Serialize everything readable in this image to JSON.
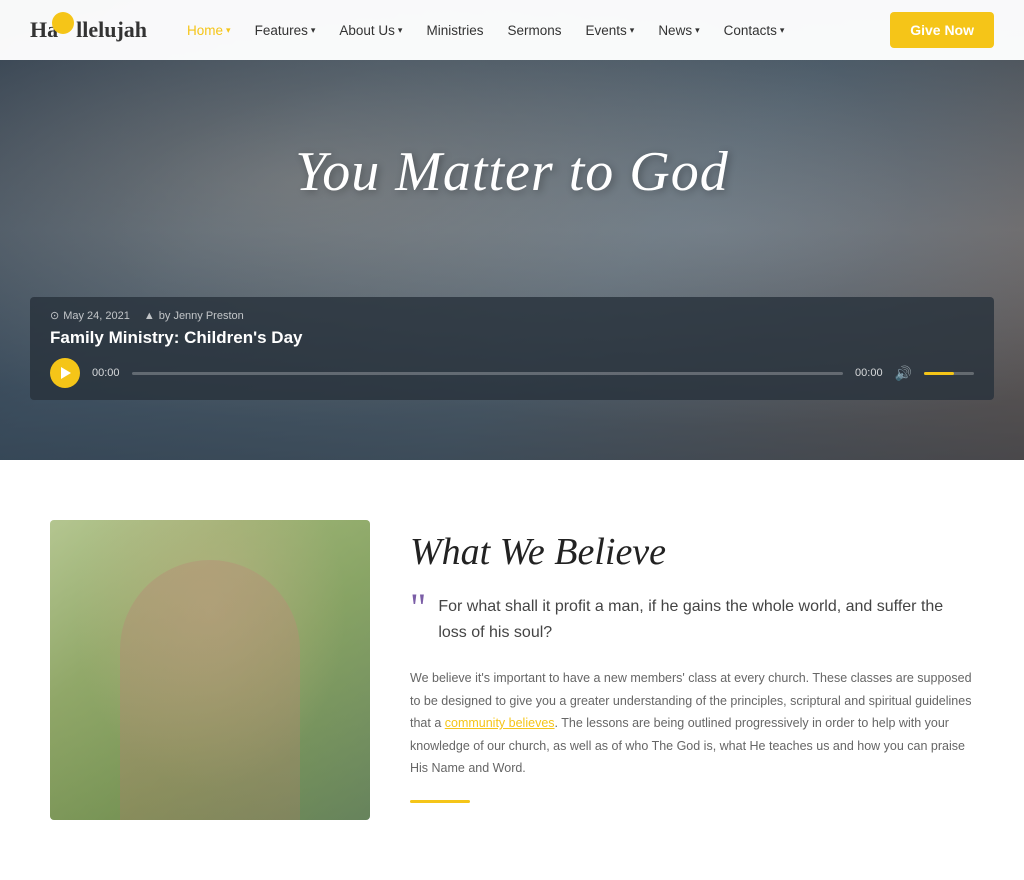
{
  "navbar": {
    "logo": "Hallelujah",
    "give_label": "Give Now",
    "links": [
      {
        "label": "Home",
        "has_arrow": true,
        "active": true
      },
      {
        "label": "Features",
        "has_arrow": true,
        "active": false
      },
      {
        "label": "About Us",
        "has_arrow": true,
        "active": false
      },
      {
        "label": "Ministries",
        "has_arrow": false,
        "active": false
      },
      {
        "label": "Sermons",
        "has_arrow": false,
        "active": false
      },
      {
        "label": "Events",
        "has_arrow": true,
        "active": false
      },
      {
        "label": "News",
        "has_arrow": true,
        "active": false
      },
      {
        "label": "Contacts",
        "has_arrow": true,
        "active": false
      }
    ]
  },
  "hero": {
    "title": "You Matter to God",
    "sermon": {
      "date": "May 24, 2021",
      "author": "by Jenny Preston",
      "title": "Family Ministry: Children's Day",
      "time_current": "00:00",
      "time_total": "00:00"
    }
  },
  "believe_section": {
    "title": "What We Believe",
    "quote": "For what shall it profit a man, if he gains the whole world, and suffer the loss of his soul?",
    "body": "We believe it's important to have a new members' class at every church. These classes are supposed to be designed to give you a greater understanding of the principles, scriptural and spiritual guidelines that a ",
    "link_text": "community believes",
    "body_after": ". The lessons are being outlined progressively in order to help with your knowledge of our church, as well as of who The God is, what He teaches us and how you can praise His Name and Word."
  }
}
